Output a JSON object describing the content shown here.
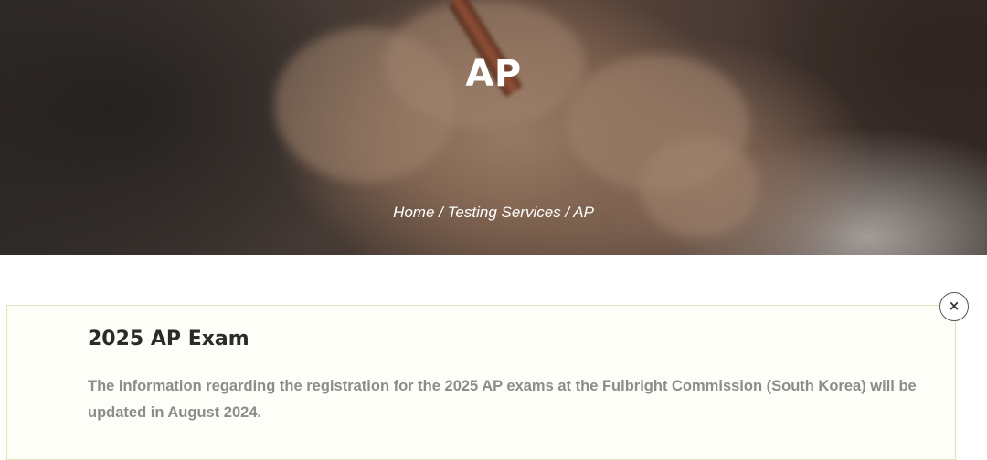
{
  "hero": {
    "title": "AP",
    "breadcrumb": {
      "home": "Home",
      "separator": " / ",
      "section": "Testing Services",
      "current": "AP"
    }
  },
  "notice": {
    "title": "2025 AP Exam",
    "body": "The information regarding the registration for the 2025 AP exams at the Fulbright Commission (South Korea) will be updated in August 2024.",
    "close_label": "×",
    "close_icon": "close-icon"
  },
  "colors": {
    "notice_background": "#fdfef8",
    "notice_border": "#dfe3b8",
    "body_text": "#8c8c8c",
    "title_text": "#2b2b2b"
  }
}
